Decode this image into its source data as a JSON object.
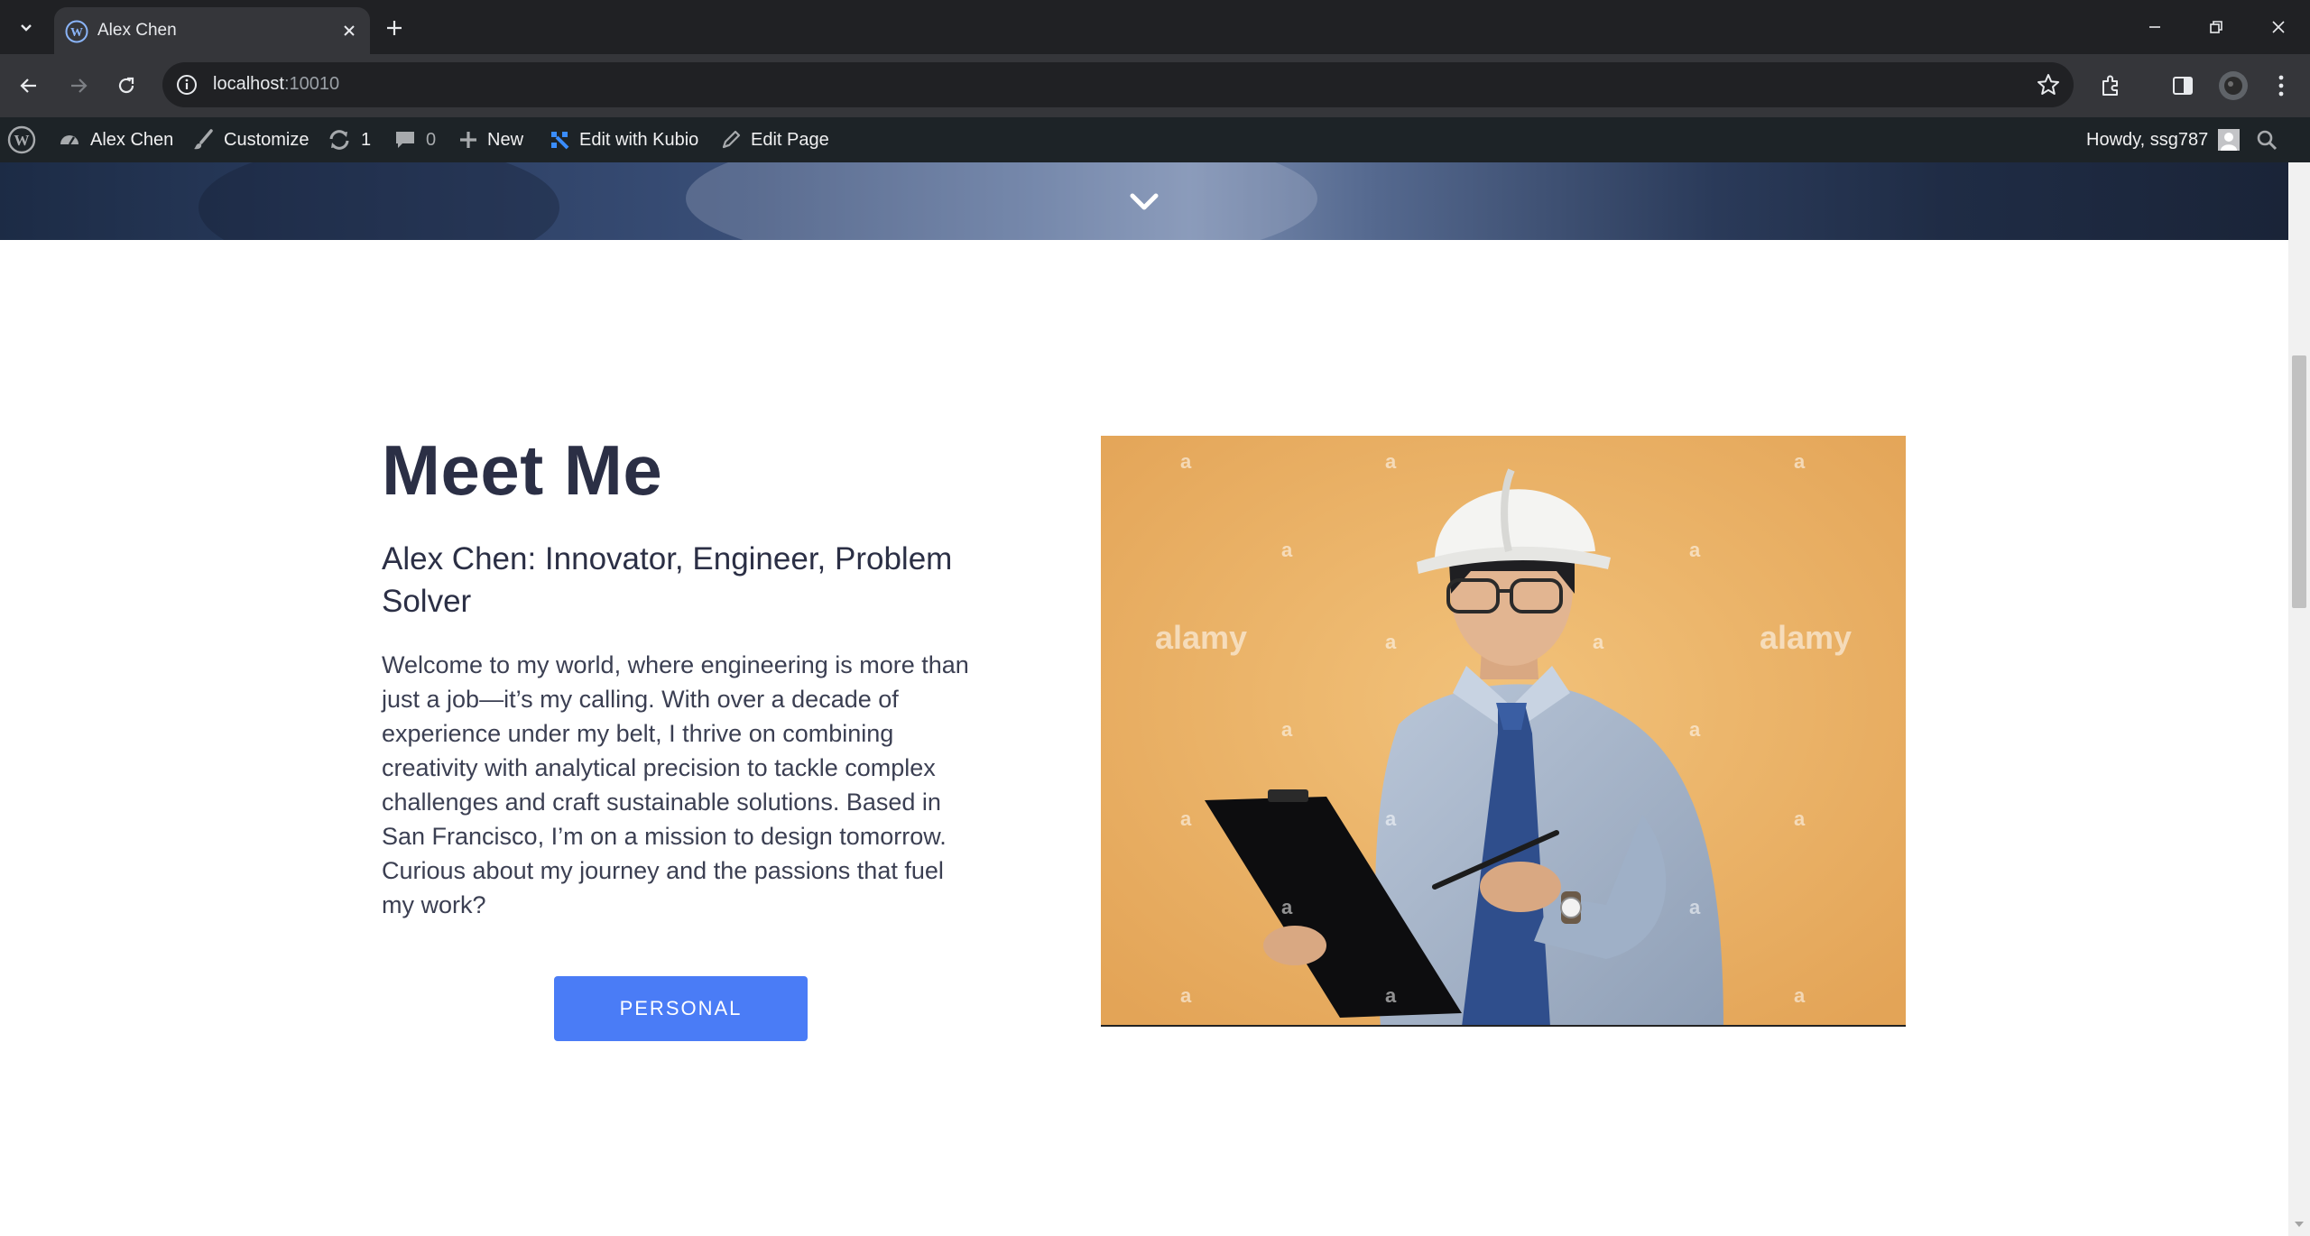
{
  "browser": {
    "tab_title": "Alex Chen",
    "url_host": "localhost",
    "url_port": ":10010"
  },
  "adminbar": {
    "site_name": "Alex Chen",
    "customize": "Customize",
    "updates_count": "1",
    "comments_count": "0",
    "new_label": "New",
    "kubio_label": "Edit with Kubio",
    "edit_page": "Edit Page",
    "howdy": "Howdy, ssg787"
  },
  "about": {
    "heading": "Meet Me",
    "subheading": "Alex Chen: Innovator, Engineer, Problem Solver",
    "bio": "Welcome to my world, where engineering is more than just a job—it’s my calling. With over a decade of experience under my belt, I thrive on combining creativity with analytical precision to tackle complex challenges and craft sustainable solutions. Based in San Francisco, I’m on a mission to design tomorrow. Curious about my journey and the passions that fuel my work?",
    "button_label": "PERSONAL"
  },
  "photo": {
    "watermark": "alamy",
    "watermark_glyph": "a"
  },
  "colors": {
    "heading": "#2b2f45",
    "button": "#4a7cf6",
    "adminbar": "#1d2327",
    "photo_bg": "#e8aa5e"
  }
}
